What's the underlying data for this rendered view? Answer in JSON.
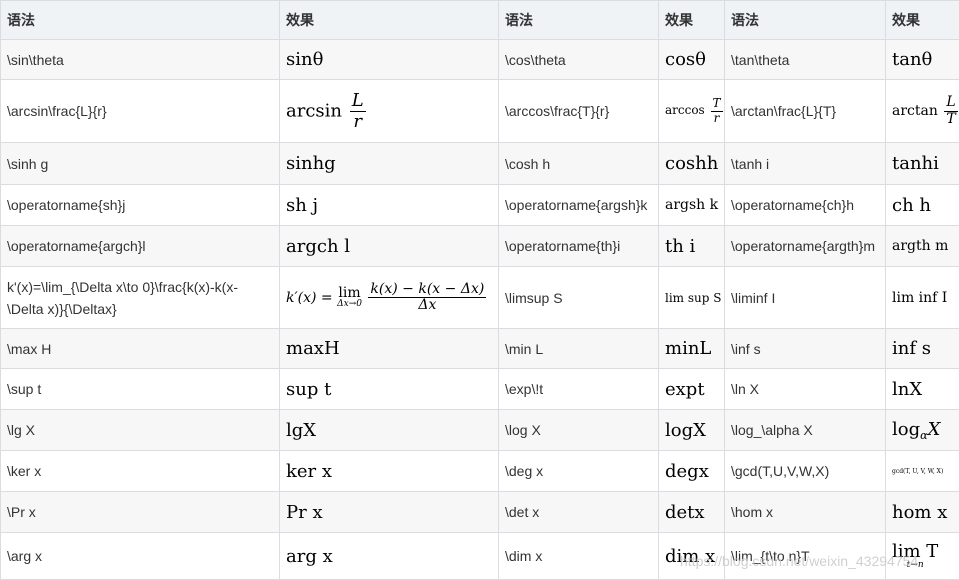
{
  "headers": [
    "语法",
    "效果",
    "语法",
    "效果",
    "语法",
    "效果"
  ],
  "rows": [
    {
      "s1": "\\sin\\theta",
      "e1": "sinθ",
      "s2": "\\cos\\theta",
      "e2": "cosθ",
      "s3": "\\tan\\theta",
      "e3": "tanθ"
    },
    {
      "s1": "\\arcsin\\frac{L}{r}",
      "e1": "arcsin",
      "e1_num": "L",
      "e1_den": "r",
      "s2": "\\arccos\\frac{T}{r}",
      "e2": "arccos",
      "e2_num": "T",
      "e2_den": "r",
      "s3": "\\arctan\\frac{L}{T}",
      "e3": "arctan",
      "e3_num": "L",
      "e3_den": "T"
    },
    {
      "s1": "\\sinh g",
      "e1": "sinhg",
      "s2": "\\cosh h",
      "e2": "coshh",
      "s3": "\\tanh i",
      "e3": "tanhi"
    },
    {
      "s1": "\\operatorname{sh}j",
      "e1": "sh j",
      "s2": "\\operatorname{argsh}k",
      "e2": "argsh k",
      "s3": "\\operatorname{ch}h",
      "e3": "ch h"
    },
    {
      "s1": "\\operatorname{argch}l",
      "e1": "argch l",
      "s2": "\\operatorname{th}i",
      "e2": "th i",
      "s3": "\\operatorname{argth}m",
      "e3": "argth m"
    },
    {
      "s1": "k'(x)=\\lim_{\\Delta x\\to 0}\\frac{k(x)-k(x-\\Delta x)}{\\Deltax}",
      "e1_lhs": "k′(x) =",
      "e1_lim": "lim",
      "e1_limsub": "Δx→0",
      "e1_num": "k(x) − k(x − Δx)",
      "e1_den": "Δx",
      "s2": "\\limsup S",
      "e2": "lim sup S",
      "s3": "\\liminf I",
      "e3": "lim inf I"
    },
    {
      "s1": "\\max H",
      "e1": "maxH",
      "s2": "\\min L",
      "e2": "minL",
      "s3": "\\inf s",
      "e3": "inf s"
    },
    {
      "s1": "\\sup t",
      "e1": "sup t",
      "s2": "\\exp\\!t",
      "e2": "expt",
      "s3": "\\ln X",
      "e3": "lnX"
    },
    {
      "s1": "\\lg X",
      "e1": "lgX",
      "s2": "\\log X",
      "e2": "logX",
      "s3": "\\log_\\alpha X",
      "e3": "log",
      "e3_sub": "α",
      "e3_tail": "X"
    },
    {
      "s1": "\\ker x",
      "e1": "ker x",
      "s2": "\\deg x",
      "e2": "degx",
      "s3": "\\gcd(T,U,V,W,X)",
      "e3": "gcd(T, U, V, W, X)"
    },
    {
      "s1": "\\Pr x",
      "e1": "Pr x",
      "s2": "\\det x",
      "e2": "detx",
      "s3": "\\hom x",
      "e3": "hom x"
    },
    {
      "s1": "\\arg x",
      "e1": "arg x",
      "s2": "\\dim x",
      "e2": "dim x",
      "s3": "\\lim_{t\\to n}T",
      "e3": "lim T",
      "e3_sub": "t→n"
    }
  ],
  "watermark": "https://blog.csdn.net/weixin_43294754"
}
